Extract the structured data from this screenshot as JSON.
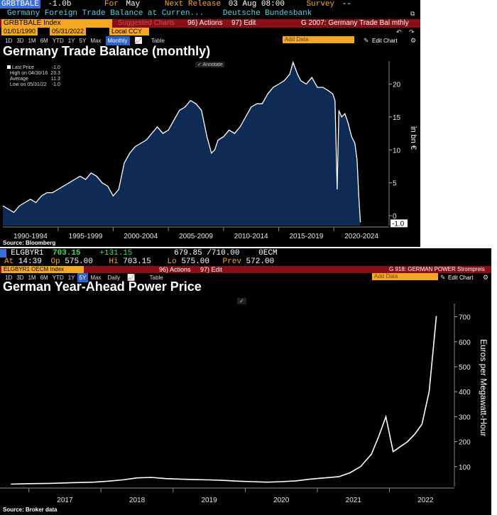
{
  "panel1": {
    "header": {
      "ticker": "GRBTBALE",
      "last": "-1.0b",
      "for_label": "For",
      "for_value": "May",
      "next_label": "Next Release",
      "next_value": "03 Aug 08:00",
      "survey_label": "Survey",
      "survey_value": "--",
      "description": "Germany Foreign Trade Balance at Curren...",
      "source": "Deutsche Bundesbank"
    },
    "toolbar": {
      "index": "GRBTBALE Index",
      "suggested": "Suggested Charts",
      "actions": "96) Actions",
      "edit": "97) Edit",
      "chart_name": "G 2007: Germany Trade Bal mthly",
      "date_from": "01/01/1990",
      "date_to": "05/31/2022",
      "currency": "Local CCY",
      "periods": [
        "1D",
        "3D",
        "1M",
        "6M",
        "YTD",
        "1Y",
        "5Y",
        "Max"
      ],
      "frequency": "Monthly",
      "table": "Table",
      "add_data": "Add Data",
      "edit_chart": "Edit Chart",
      "annotate": "Annotate"
    },
    "title": "Germany Trade Balance (monthly)",
    "legend": [
      {
        "label": "Last Price",
        "value": "-1.0"
      },
      {
        "label": "High on 04/30/16",
        "value": "23.3"
      },
      {
        "label": "Average",
        "value": "11.3"
      },
      {
        "label": "Low on 05/31/22",
        "value": "-1.0"
      }
    ],
    "source": "Source: Bloomberg",
    "last_value_label": "-1.0"
  },
  "panel2": {
    "header": {
      "ticker": "ELGBYR1",
      "last": "703.15",
      "change": "+131.15",
      "range": "679.85 /710.00",
      "exchange": "0ECM",
      "at_label": "At",
      "at_value": "14:39",
      "op_label": "Op",
      "op_value": "575.00",
      "hi_label": "Hi",
      "hi_value": "703.15",
      "lo_label": "Lo",
      "lo_value": "575.00",
      "prev_label": "Prev",
      "prev_value": "572.00"
    },
    "toolbar": {
      "index": "ELGBYR1 OECM Index",
      "actions": "96) Actions",
      "edit": "97) Edit",
      "chart_name": "G 918: GERMAN POWER Strompreis",
      "periods": [
        "1D",
        "3D",
        "1M",
        "6M",
        "YTD",
        "1Y",
        "5Y",
        "Max"
      ],
      "frequency": "Daily",
      "table": "Table",
      "add_data": "Add Data",
      "edit_chart": "Edit Chart"
    },
    "title": "German Year-Ahead Power Price",
    "source": "Source: Broker data"
  },
  "chart_data": [
    {
      "type": "area",
      "title": "Germany Trade Balance (monthly)",
      "ylabel": "in bn €",
      "ylim": [
        -1.5,
        23.5
      ],
      "yticks": [
        0,
        5,
        10,
        15,
        20
      ],
      "x_tick_labels": [
        "1990-1994",
        "1995-1999",
        "2000-2004",
        "2005-2009",
        "2010-2014",
        "2015-2019",
        "2020-2024"
      ],
      "grid": false,
      "legend_position": "top-left",
      "colors": {
        "line": "#ffffff",
        "fill": "#0d2b55"
      },
      "series": [
        {
          "x": [
            1990.0,
            1990.5,
            1991.0,
            1991.5,
            1992.0,
            1992.5,
            1993.0,
            1993.5,
            1994.0,
            1994.5,
            1995.0,
            1995.5,
            1996.0,
            1996.5,
            1997.0,
            1997.5,
            1998.0,
            1998.5,
            1999.0,
            1999.5,
            2000.0,
            2000.5,
            2001.0,
            2001.5,
            2002.0,
            2002.5,
            2003.0,
            2003.5,
            2004.0,
            2004.5,
            2005.0,
            2005.5,
            2006.0,
            2006.5,
            2007.0,
            2007.5,
            2008.0,
            2008.5,
            2008.9,
            2009.2,
            2009.5,
            2010.0,
            2010.5,
            2011.0,
            2011.5,
            2012.0,
            2012.5,
            2013.0,
            2013.5,
            2014.0,
            2014.5,
            2015.0,
            2015.5,
            2016.0,
            2016.3,
            2016.7,
            2017.0,
            2017.5,
            2018.0,
            2018.5,
            2019.0,
            2019.5,
            2019.9,
            2020.1,
            2020.3,
            2020.45,
            2020.7,
            2021.0,
            2021.3,
            2021.6,
            2021.9,
            2022.1,
            2022.25,
            2022.4
          ],
          "y": [
            1.5,
            1.0,
            0.5,
            1.5,
            2.0,
            2.5,
            2.0,
            3.0,
            3.5,
            3.5,
            4.0,
            4.5,
            5.0,
            5.5,
            6.0,
            5.5,
            6.5,
            6.0,
            5.0,
            4.5,
            3.0,
            4.0,
            8.0,
            9.5,
            10.5,
            11.0,
            11.5,
            12.5,
            13.5,
            12.5,
            13.0,
            14.5,
            16.0,
            16.5,
            17.5,
            17.0,
            16.0,
            12.0,
            9.5,
            10.0,
            11.5,
            12.0,
            13.0,
            12.5,
            13.5,
            15.0,
            16.5,
            17.0,
            17.0,
            18.5,
            19.5,
            20.0,
            20.5,
            21.5,
            23.3,
            21.5,
            20.5,
            20.0,
            21.0,
            19.5,
            19.5,
            19.0,
            18.5,
            17.5,
            4.0,
            16.0,
            15.0,
            15.5,
            14.0,
            12.0,
            11.0,
            8.5,
            3.0,
            -1.0
          ]
        }
      ]
    },
    {
      "type": "line",
      "title": "German Year-Ahead Power Price",
      "ylabel": "Euros per Megawatt-Hour",
      "ylim": [
        20,
        730
      ],
      "yticks": [
        100,
        200,
        300,
        400,
        500,
        600,
        700
      ],
      "x_tick_labels": [
        "2017",
        "2018",
        "2019",
        "2020",
        "2021",
        "2022"
      ],
      "grid": false,
      "colors": {
        "line": "#ffffff"
      },
      "series": [
        {
          "x": [
            2016.75,
            2017.0,
            2017.3,
            2017.6,
            2017.9,
            2018.1,
            2018.3,
            2018.5,
            2018.7,
            2018.9,
            2019.1,
            2019.3,
            2019.5,
            2019.7,
            2019.9,
            2020.1,
            2020.3,
            2020.5,
            2020.7,
            2020.9,
            2021.1,
            2021.3,
            2021.45,
            2021.6,
            2021.75,
            2021.85,
            2021.95,
            2022.05,
            2022.15,
            2022.25,
            2022.35,
            2022.45,
            2022.55,
            2022.6,
            2022.65
          ],
          "y": [
            30,
            32,
            33,
            36,
            38,
            42,
            47,
            55,
            57,
            52,
            50,
            48,
            47,
            45,
            42,
            40,
            38,
            40,
            43,
            50,
            55,
            60,
            75,
            100,
            150,
            220,
            300,
            160,
            180,
            200,
            230,
            270,
            400,
            550,
            703
          ]
        }
      ]
    }
  ]
}
